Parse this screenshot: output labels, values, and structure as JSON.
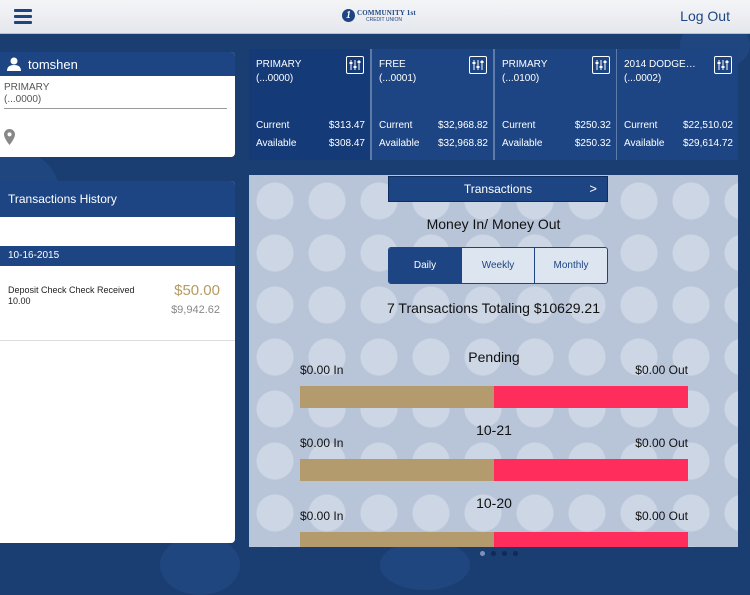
{
  "header": {
    "logo_line1": "COMMUNITY 1st",
    "logo_line2": "CREDIT UNION",
    "logout_label": "Log Out"
  },
  "user": {
    "username": "tomshen",
    "account_line1": "PRIMARY",
    "account_line2": "(...0000)"
  },
  "history": {
    "title": "Transactions History",
    "date": "10-16-2015",
    "transaction": {
      "description": "Deposit Check Check Received 10.00",
      "amount": "$50.00",
      "balance": "$9,942.62"
    }
  },
  "accounts": [
    {
      "name": "PRIMARY",
      "number": "(...0000)",
      "current_label": "Current",
      "current": "$313.47",
      "available_label": "Available",
      "available": "$308.47"
    },
    {
      "name": "FREE",
      "number": "(...0001)",
      "current_label": "Current",
      "current": "$32,968.82",
      "available_label": "Available",
      "available": "$32,968.82"
    },
    {
      "name": "PRIMARY",
      "number": "(...0100)",
      "current_label": "Current",
      "current": "$250.32",
      "available_label": "Available",
      "available": "$250.32"
    },
    {
      "name": "2014 DODGE…",
      "number": "(...0002)",
      "current_label": "Current",
      "current": "$22,510.02",
      "available_label": "Available",
      "available": "$29,614.72"
    }
  ],
  "main": {
    "transactions_button": "Transactions",
    "transactions_chevron": ">",
    "money_title": "Money In/ Money Out",
    "tabs": [
      "Daily",
      "Weekly",
      "Monthly"
    ],
    "active_tab": "Daily",
    "total_text": "7 Transactions Totaling $10629.21",
    "groups": [
      {
        "label": "Pending",
        "in": "$0.00 In",
        "out": "$0.00 Out",
        "in_share": 0.5
      },
      {
        "label": "10-21",
        "in": "$0.00 In",
        "out": "$0.00 Out",
        "in_share": 0.5
      },
      {
        "label": "10-20",
        "in": "$0.00 In",
        "out": "$0.00 Out",
        "in_share": 0.5
      }
    ]
  },
  "pagination": {
    "pages": 4,
    "current": 1
  },
  "colors": {
    "brand": "#1e4583",
    "money_in": "#b39b6e",
    "money_out": "#ff2d5c",
    "amount_gold": "#b59b63"
  },
  "icons": [
    "menu-icon",
    "user-icon",
    "location-pin-icon",
    "adjust-sliders-icon",
    "chevron-right-icon"
  ]
}
